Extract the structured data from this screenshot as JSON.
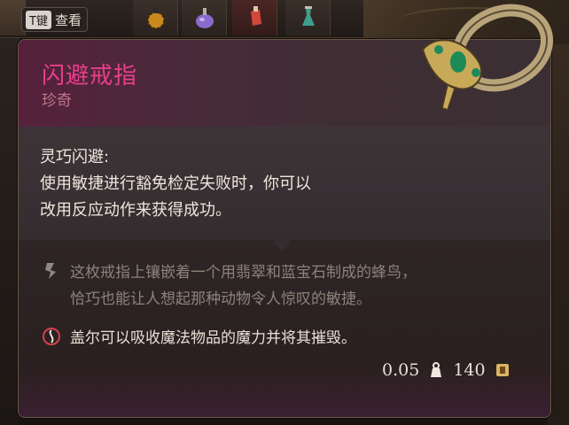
{
  "inventory": {
    "key_hint": {
      "key": "T键",
      "label": "查看"
    },
    "slots": [
      "potion-orange-icon",
      "potion-purple-icon",
      "potion-red-icon",
      "potion-green-icon"
    ]
  },
  "tooltip": {
    "title": "闪避戒指",
    "rarity": "珍奇",
    "ability_name": "灵巧闪避:",
    "ability_lines": [
      "使用敏捷进行豁免检定失败时，你可以",
      "改用反应动作来获得成功。"
    ],
    "lore_lines": [
      "这枚戒指上镶嵌着一个用翡翠和蓝宝石制成的蜂鸟，",
      "恰巧也能让人想起那种动物令人惊叹的敏捷。"
    ],
    "note": "盖尔可以吸收魔法物品的魔力并将其摧毁。",
    "weight": "0.05",
    "value": "140"
  },
  "colors": {
    "title": "#e83f8c",
    "rarity": "#c0768c",
    "text": "#efe6dc",
    "lore": "#8c837c"
  }
}
